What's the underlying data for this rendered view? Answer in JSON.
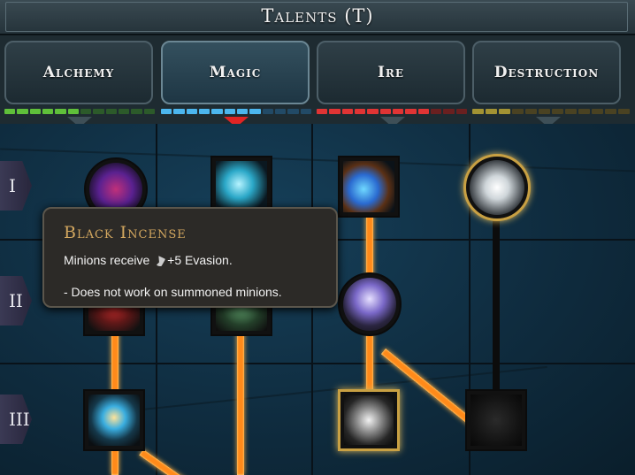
{
  "window": {
    "title": "Talents (T)"
  },
  "tabs": [
    {
      "label": "Alchemy",
      "active": false,
      "color": "#3fae3a"
    },
    {
      "label": "Magic",
      "active": true,
      "color": "#3fa7e0"
    },
    {
      "label": "Ire",
      "active": false,
      "color": "#d93030"
    },
    {
      "label": "Destruction",
      "active": false,
      "color": "#9a8a3a"
    }
  ],
  "rows": [
    "I",
    "II",
    "III"
  ],
  "nodes": [
    {
      "name": "alchemy-talent-1-icon",
      "icon": "demon-mask-icon"
    },
    {
      "name": "magic-talent-1-icon",
      "icon": "spectral-claw-icon"
    },
    {
      "name": "ire-talent-1-icon",
      "icon": "ghost-boot-icon"
    },
    {
      "name": "destruction-talent-1-icon",
      "icon": "open-book-icon"
    },
    {
      "name": "ire-talent-2-icon",
      "icon": "spirit-brazier-icon"
    },
    {
      "name": "alchemy-talent-3-icon",
      "icon": "glowing-chalice-icon"
    },
    {
      "name": "ire-talent-3-icon",
      "icon": "clawed-hand-icon"
    },
    {
      "name": "destruction-talent-3-icon",
      "icon": "dark-claw-icon"
    }
  ],
  "tooltip": {
    "title": "Black Incense",
    "line1_prefix": "Minions receive",
    "line1_suffix": "+5 Evasion.",
    "line2": "- Does not work on summoned minions.",
    "title_color": "#d3a75f"
  }
}
